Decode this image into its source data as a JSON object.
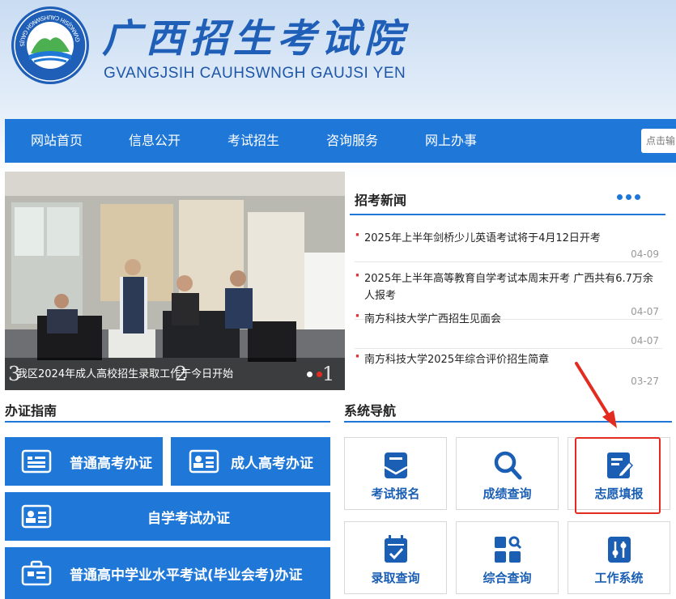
{
  "header": {
    "title_cn": "广西招生考试院",
    "title_en": "GVANGJSIH CAUHSWNGH GAUJSI YEN",
    "logo_ring_text": "GVANGJSIH CAUHSWNGH GAUJSI YEN",
    "logo_top_text": "广西招生考试院"
  },
  "nav": {
    "items": [
      "网站首页",
      "信息公开",
      "考试招生",
      "咨询服务",
      "网上办事"
    ],
    "search_placeholder": "点击输"
  },
  "slideshow": {
    "caption": "我区2024年成人高校招生录取工作于今日开始",
    "num_left": "3",
    "num_right": "1",
    "num_mid": "2"
  },
  "news": {
    "title": "招考新闻",
    "items": [
      {
        "title": "2025年上半年剑桥少儿英语考试将于4月12日开考",
        "date": "04-09"
      },
      {
        "title": "2025年上半年高等教育自学考试本周末开考 广西共有6.7万余人报考",
        "date": "04-07"
      },
      {
        "title": "南方科技大学广西招生见面会",
        "date": "04-07"
      },
      {
        "title": "南方科技大学2025年综合评价招生简章",
        "date": "03-27"
      }
    ]
  },
  "cert_guide": {
    "title": "办证指南",
    "buttons": [
      "普通高考办证",
      "成人高考办证",
      "自学考试办证",
      "普通高中学业水平考试(毕业会考)办证"
    ]
  },
  "system_nav": {
    "title": "系统导航",
    "tiles": [
      "考试报名",
      "成绩查询",
      "志愿填报",
      "录取查询",
      "综合查询",
      "工作系统"
    ]
  },
  "colors": {
    "primary": "#1f78d8",
    "tile_text": "#1a5fb4",
    "highlight": "#e32b20"
  }
}
